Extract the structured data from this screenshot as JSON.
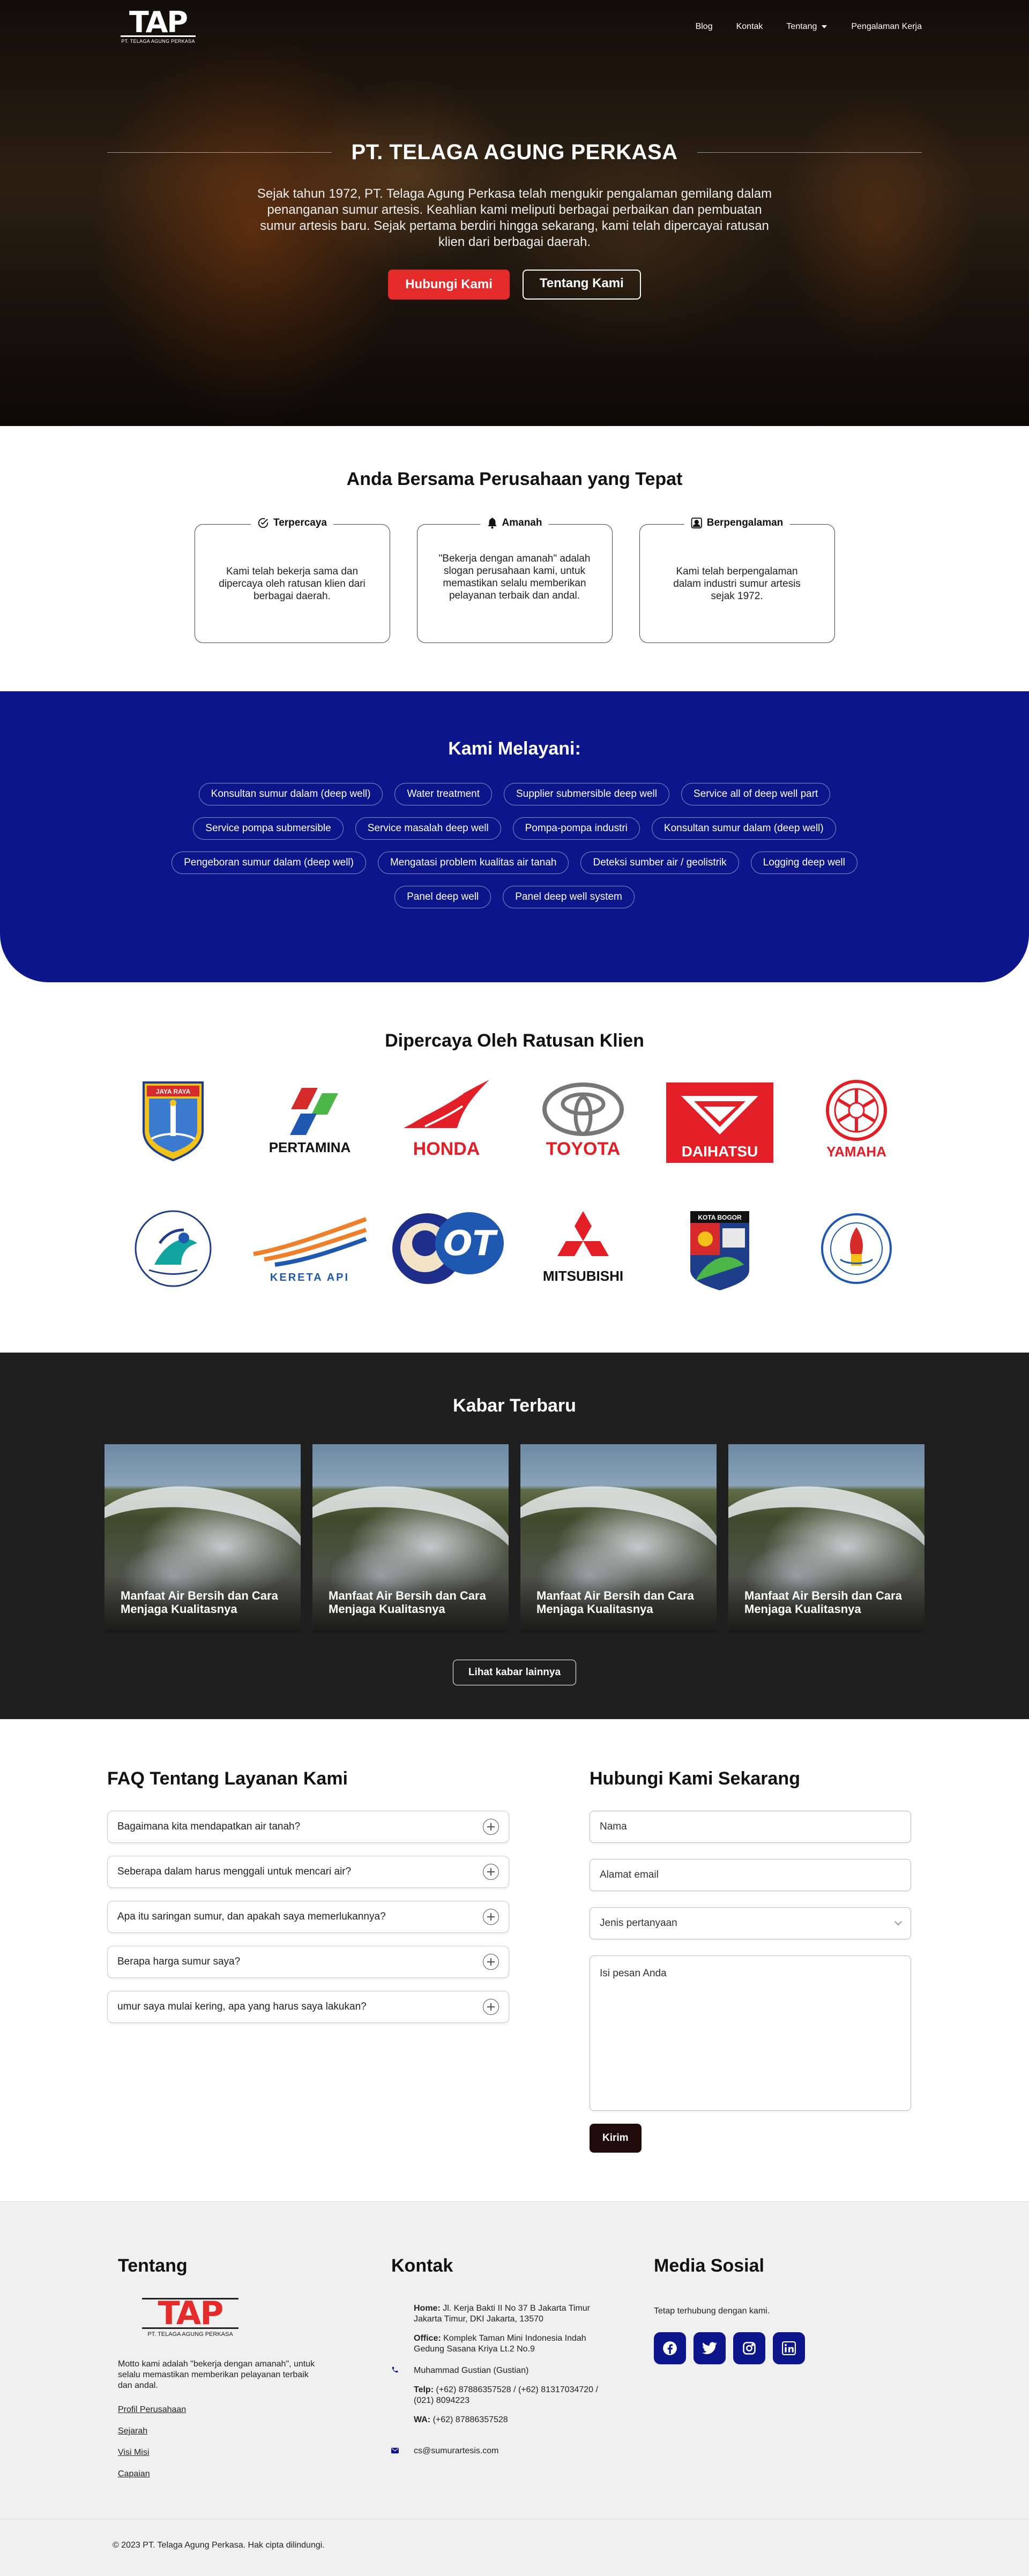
{
  "nav": {
    "logo_text": "TAP",
    "logo_sub": "PT. TELAGA AGUNG PERKASA",
    "links": [
      "Blog",
      "Kontak",
      "Tentang",
      "Pengalaman Kerja"
    ]
  },
  "hero": {
    "title": "PT. TELAGA AGUNG PERKASA",
    "description": "Sejak tahun 1972, PT. Telaga Agung Perkasa telah mengukir pengalaman gemilang dalam penanganan sumur artesis. Keahlian kami meliputi berbagai perbaikan dan pembuatan sumur artesis baru. Sejak pertama berdiri hingga sekarang, kami telah dipercayai ratusan klien dari berbagai daerah.",
    "primary_button": "Hubungi Kami",
    "secondary_button": "Tentang Kami"
  },
  "advantages": {
    "title": "Anda Bersama Perusahaan yang Tepat",
    "cards": [
      {
        "title": "Terpercaya",
        "text": "Kami telah bekerja sama dan dipercaya oleh ratusan klien dari berbagai daerah.",
        "icon": "check-circle-icon"
      },
      {
        "title": "Amanah",
        "text": "\"Bekerja dengan amanah\" adalah slogan perusahaan kami, untuk memastikan selalu memberikan pelayanan terbaik dan andal.",
        "icon": "bell-icon"
      },
      {
        "title": "Berpengalaman",
        "text": "Kami telah berpengalaman dalam industri sumur artesis sejak 1972.",
        "icon": "id-card-icon"
      }
    ]
  },
  "services": {
    "title": "Kami Melayani:",
    "items": [
      "Konsultan sumur dalam (deep well)",
      "Water treatment",
      "Supplier submersible deep well",
      "Service all of deep well part",
      "Service pompa submersible",
      "Service masalah deep well",
      "Pompa-pompa industri",
      "Konsultan sumur dalam (deep well)",
      "Pengeboran sumur dalam (deep well)",
      "Mengatasi problem kualitas air tanah",
      "Deteksi sumber air / geolistrik",
      "Logging deep well",
      "Panel deep well",
      "Panel deep well system"
    ]
  },
  "clients": {
    "title": "Dipercaya Oleh Ratusan Klien",
    "logos": [
      {
        "name": "DKI Jakarta",
        "text": "JAYA RAYA"
      },
      {
        "name": "Pertamina",
        "text": "PERTAMINA"
      },
      {
        "name": "Honda",
        "text": "HONDA"
      },
      {
        "name": "Toyota",
        "text": "TOYOTA"
      },
      {
        "name": "Daihatsu",
        "text": "DAIHATSU"
      },
      {
        "name": "Yamaha",
        "text": "YAMAHA"
      },
      {
        "name": "Kementerian Kelautan dan Perikanan",
        "text": ""
      },
      {
        "name": "Kereta Api",
        "text": "KERETA API"
      },
      {
        "name": "OT",
        "text": "OT"
      },
      {
        "name": "Mitsubishi",
        "text": "MITSUBISHI"
      },
      {
        "name": "Kota Bogor",
        "text": "KOTA BOGOR"
      },
      {
        "name": "Kemenpora",
        "text": ""
      }
    ]
  },
  "news": {
    "title": "Kabar Terbaru",
    "items": [
      {
        "title": "Manfaat Air Bersih dan Cara Menjaga Kualitasnya"
      },
      {
        "title": "Manfaat Air Bersih dan Cara Menjaga Kualitasnya"
      },
      {
        "title": "Manfaat Air Bersih dan Cara Menjaga Kualitasnya"
      },
      {
        "title": "Manfaat Air Bersih dan Cara Menjaga Kualitasnya"
      }
    ],
    "more_button": "Lihat kabar lainnya"
  },
  "faq": {
    "title": "FAQ Tentang Layanan Kami",
    "items": [
      "Bagaimana kita mendapatkan air tanah?",
      "Seberapa dalam harus menggali untuk mencari air?",
      "Apa itu saringan sumur, dan apakah saya memerlukannya?",
      "Berapa harga sumur saya?",
      "umur saya mulai kering, apa yang harus saya lakukan?"
    ]
  },
  "contact_form": {
    "title": "Hubungi Kami Sekarang",
    "name_placeholder": "Nama",
    "email_placeholder": "Alamat email",
    "type_placeholder": "Jenis pertanyaan",
    "message_placeholder": "Isi pesan Anda",
    "submit": "Kirim"
  },
  "footer": {
    "about": {
      "title": "Tentang",
      "logo_text": "TAP",
      "logo_sub": "PT. TELAGA AGUNG PERKASA",
      "motto": "Motto kami adalah \"bekerja dengan amanah\", untuk selalu memastikan memberikan pelayanan terbaik dan andal.",
      "links": [
        "Profil Perusahaan",
        "Sejarah",
        "Visi Misi",
        "Capaian"
      ]
    },
    "contact": {
      "title": "Kontak",
      "home_label": "Home:",
      "home": "Jl. Kerja Bakti II No 37 B Jakarta Timur Jakarta Timur, DKI Jakarta, 13570",
      "office_label": "Office:",
      "office": "Komplek Taman Mini Indonesia Indah Gedung Sasana Kriya Lt.2 No.9",
      "person": "Muhammad Gustian (Gustian)",
      "telp_label": "Telp:",
      "telp": "(+62) 87886357528 / (+62) 81317034720 / (021) 8094223",
      "wa_label": "WA:",
      "wa": "(+62) 87886357528",
      "email": "cs@sumurartesis.com"
    },
    "social": {
      "title": "Media Sosial",
      "description": "Tetap terhubung dengan kami.",
      "icons": [
        "facebook-icon",
        "twitter-icon",
        "instagram-icon",
        "linkedin-icon"
      ]
    },
    "copyright": "© 2023 PT. Telaga Agung Perkasa. Hak cipta dilindungi."
  },
  "colors": {
    "brand_blue": "#0c168a",
    "brand_red": "#e52a2a",
    "dark": "#1f1f1f"
  }
}
